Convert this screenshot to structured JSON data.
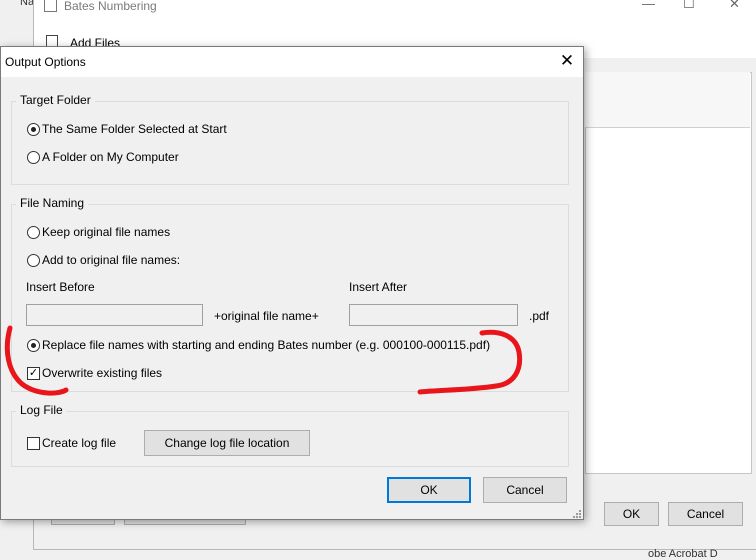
{
  "background_window": {
    "title": "Bates Numbering",
    "left_label": "Na",
    "minimize": "—",
    "maximize": "☐",
    "close": "✕",
    "add_files_label": "Add Files",
    "ok_label": "OK",
    "cancel_label": "Cancel",
    "status_text": "obe Acrobat D"
  },
  "dialog": {
    "title": "Output Options",
    "close_glyph": "✕",
    "target_folder": {
      "legend": "Target Folder",
      "options": [
        {
          "label": "The Same Folder Selected at Start",
          "selected": true
        },
        {
          "label": "A Folder on My Computer",
          "selected": false
        }
      ]
    },
    "file_naming": {
      "legend": "File Naming",
      "keep_original": "Keep original file names",
      "add_to_original": "Add to original file names:",
      "insert_before_label": "Insert Before",
      "insert_after_label": "Insert After",
      "insert_before_value": "",
      "insert_after_value": "",
      "middle_text": "+original file name+",
      "extension_text": ".pdf",
      "replace_label": "Replace file names with starting and ending Bates number (e.g. 000100-000115.pdf)",
      "replace_selected": true,
      "overwrite_label": "Overwrite existing files",
      "overwrite_checked": true
    },
    "log_file": {
      "legend": "Log File",
      "create_label": "Create log file",
      "create_checked": false,
      "change_location_label": "Change log file location"
    },
    "ok_label": "OK",
    "cancel_label": "Cancel"
  },
  "colors": {
    "annotation_red": "#e8161b",
    "default_button_border": "#0078d7"
  }
}
